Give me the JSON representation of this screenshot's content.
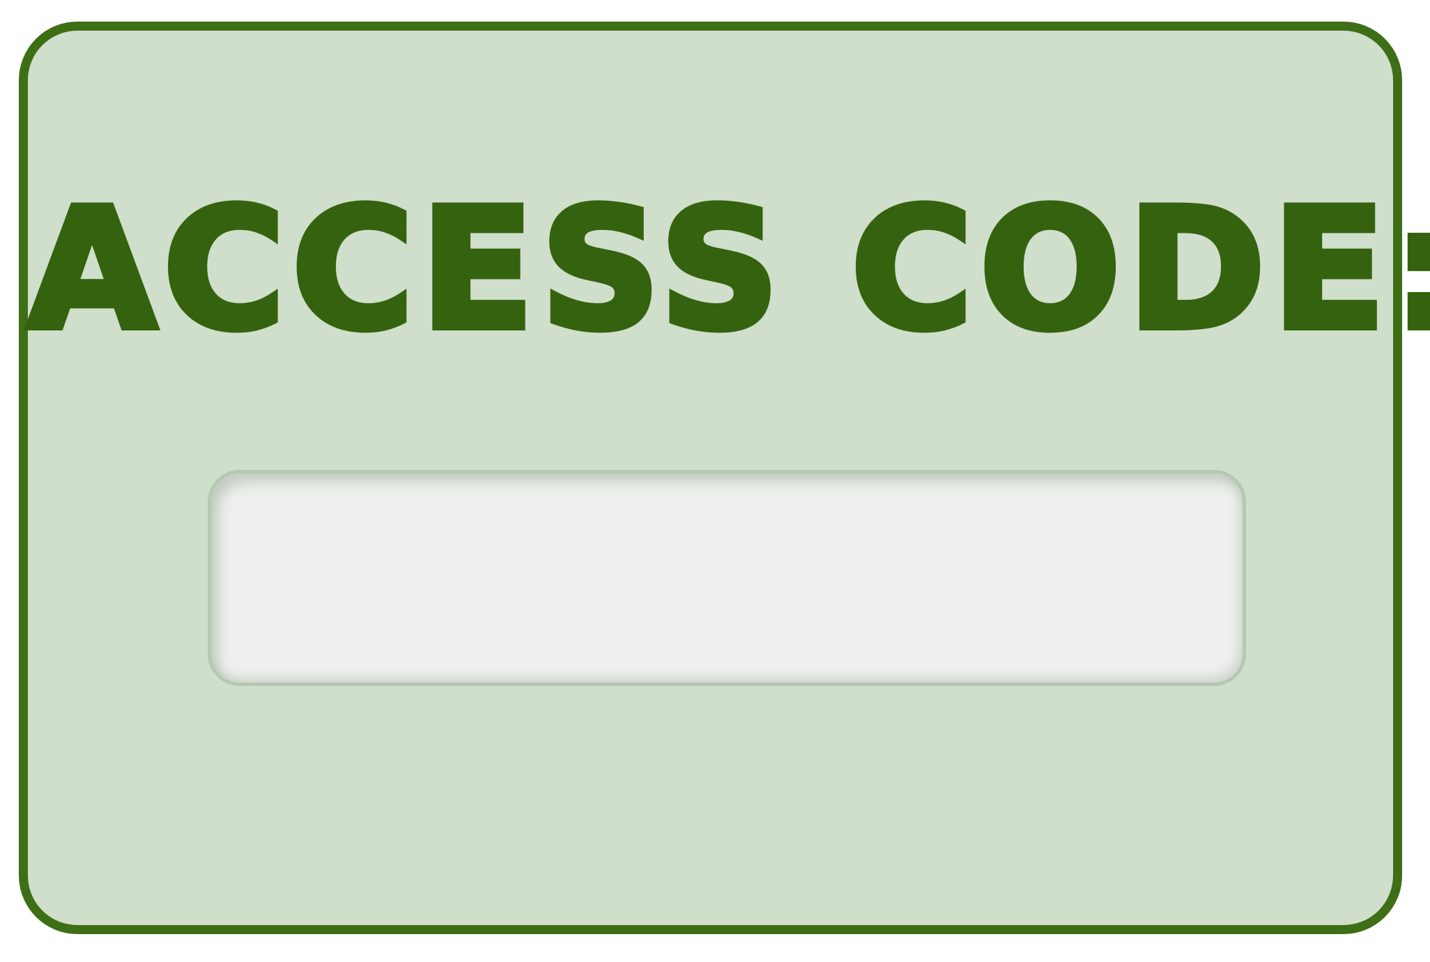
{
  "prompt": {
    "label": "ACCESS CODE:"
  },
  "code_field": {
    "value": "",
    "placeholder": ""
  },
  "colors": {
    "panel_background": "#cfdfcb",
    "panel_border": "#3e6e16",
    "text": "#35620e",
    "field_background": "#edf0ec",
    "field_border": "#b5c8b3"
  }
}
